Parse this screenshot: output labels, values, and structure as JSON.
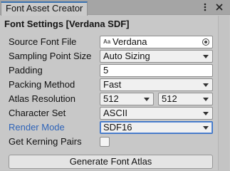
{
  "window": {
    "tab_title": "Font Asset Creator"
  },
  "section": {
    "title": "Font Settings [Verdana SDF]"
  },
  "fields": {
    "source_font_file": {
      "label": "Source Font File",
      "value": "Verdana",
      "icon": "Aa"
    },
    "sampling_point_size": {
      "label": "Sampling Point Size",
      "value": "Auto Sizing"
    },
    "padding": {
      "label": "Padding",
      "value": "5"
    },
    "packing_method": {
      "label": "Packing Method",
      "value": "Fast"
    },
    "atlas_resolution": {
      "label": "Atlas Resolution",
      "width": "512",
      "height": "512"
    },
    "character_set": {
      "label": "Character Set",
      "value": "ASCII"
    },
    "render_mode": {
      "label": "Render Mode",
      "value": "SDF16"
    },
    "get_kerning_pairs": {
      "label": "Get Kerning Pairs",
      "checked": false
    }
  },
  "actions": {
    "generate_label": "Generate Font Atlas"
  },
  "icons": {
    "tab_menu": "kebab-icon",
    "tab_close": "close-icon",
    "object_picker": "object-picker-icon"
  },
  "colors": {
    "active_label": "#2f64b8",
    "tab_accent": "#3a72b0"
  }
}
